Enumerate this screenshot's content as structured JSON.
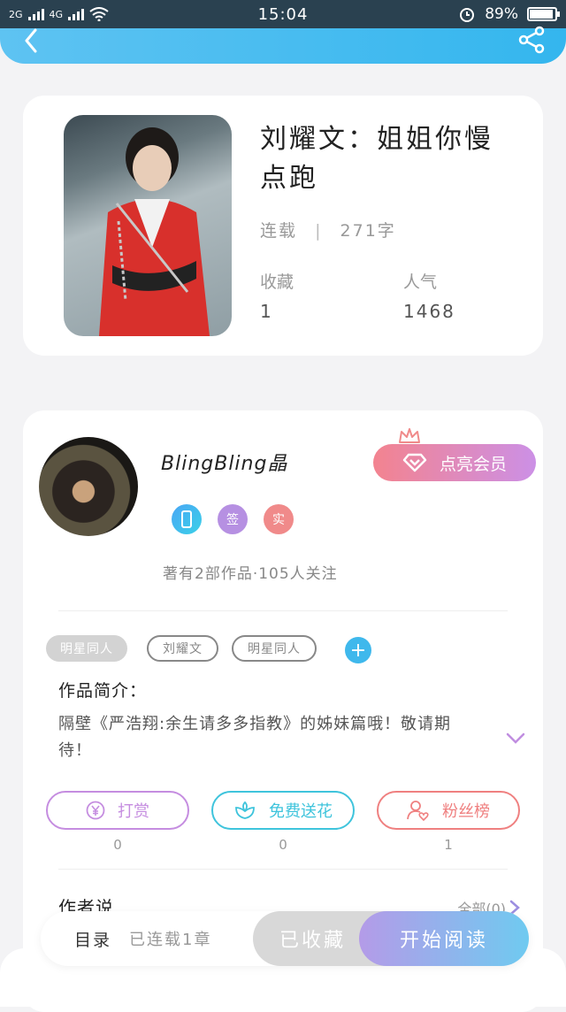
{
  "status_bar": {
    "net1": "2G",
    "net2": "4G",
    "time": "15:04",
    "battery": "89%"
  },
  "book": {
    "title": "刘耀文：姐姐你慢点跑",
    "status": "连载",
    "words": "271字",
    "collect_label": "收藏",
    "collect_value": "1",
    "popularity_label": "人气",
    "popularity_value": "1468"
  },
  "author": {
    "name": "BlingBling晶",
    "vip_label": "点亮会员",
    "badges": [
      "",
      "签",
      "实"
    ],
    "works_line": "著有2部作品·105人关注",
    "tags": [
      "明星同人",
      "刘耀文",
      "明星同人"
    ],
    "intro_heading": "作品简介：",
    "intro_text": "隔壁《严浩翔:余生请多多指教》的姊妹篇哦！敬请期待！"
  },
  "actions": [
    {
      "label": "打赏",
      "count": "0",
      "color": "#c58de0"
    },
    {
      "label": "免费送花",
      "count": "0",
      "color": "#3fc4dc"
    },
    {
      "label": "粉丝榜",
      "count": "1",
      "color": "#ef8080"
    }
  ],
  "author_says": {
    "heading": "作者说",
    "all_label": "全部(0)"
  },
  "bottom": {
    "toc": "目录",
    "toc_sub": "已连载1章",
    "collected": "已收藏",
    "read": "开始阅读"
  },
  "colors": {
    "accent": "#34b6ee",
    "vip_gradient_start": "#f3838f",
    "vip_gradient_end": "#cc90e6"
  }
}
